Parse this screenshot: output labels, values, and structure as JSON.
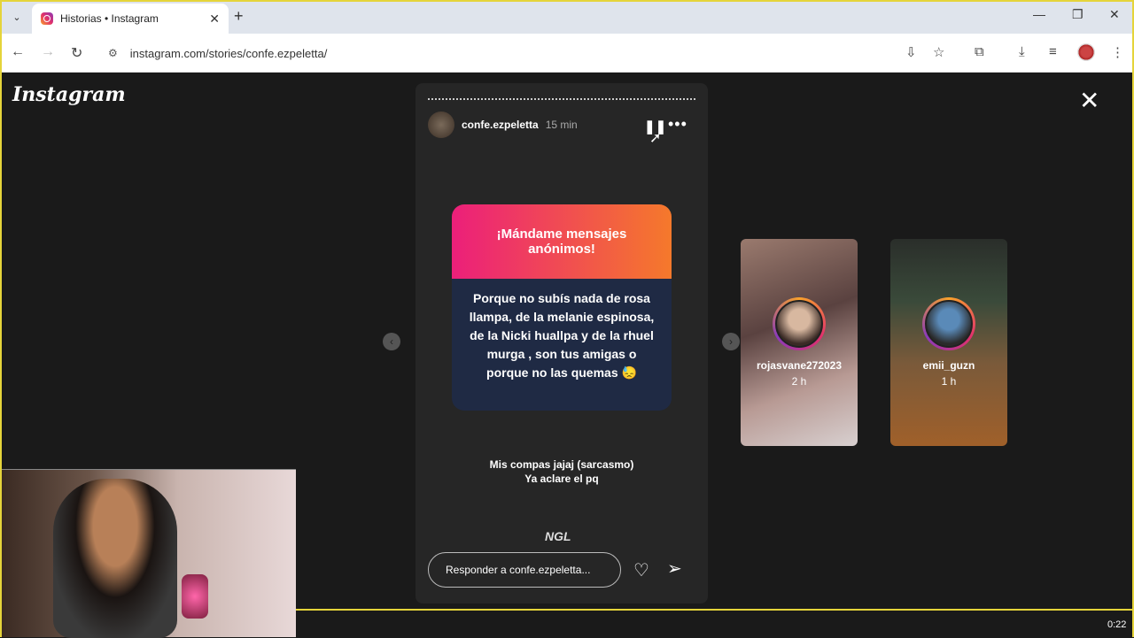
{
  "browser": {
    "tab_title": "Historias • Instagram",
    "url": "instagram.com/stories/confe.ezpeletta/"
  },
  "page": {
    "logo": "Instagram"
  },
  "story": {
    "username": "confe.ezpeletta",
    "time": "15 min",
    "ngl_header": "¡Mándame mensajes anónimos!",
    "ngl_question": "Porque no subís nada de rosa llampa, de la melanie espinosa, de la Nicki huallpa y de la rhuel murga , son tus amigas o porque no las quemas 😓",
    "reply_line1": "Mis compas jajaj (sarcasmo)",
    "reply_line2": "Ya aclare el pq",
    "ngl_mark": "NGL",
    "reply_placeholder": "Responder a confe.ezpeletta..."
  },
  "side_stories": [
    {
      "username": "rojasvane272023",
      "time": "2 h"
    },
    {
      "username": "emii_guzn",
      "time": "1 h"
    }
  ],
  "video": {
    "timestamp": "0:22"
  }
}
